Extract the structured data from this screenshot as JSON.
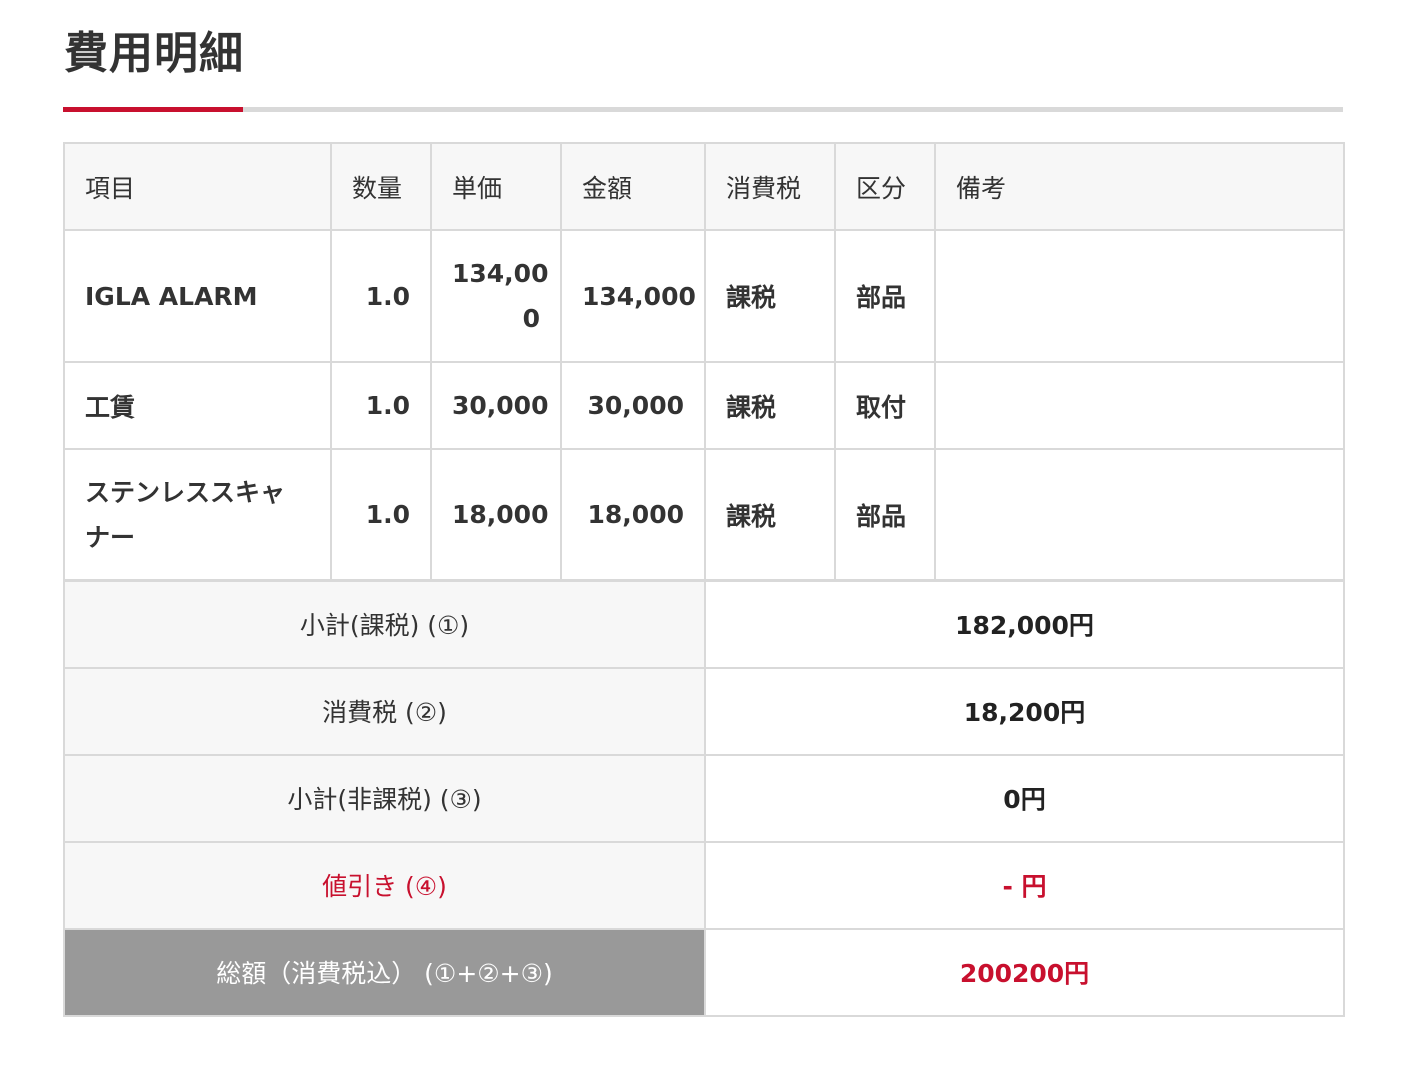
{
  "title": "費用明細",
  "table": {
    "headers": [
      "項目",
      "数量",
      "単価",
      "金額",
      "消費税",
      "区分",
      "備考"
    ],
    "rows": [
      {
        "item": "IGLA ALARM",
        "qty": "1.0",
        "unit_price_line1": "134,00",
        "unit_price_line2": "0",
        "amount": "134,000",
        "tax": "課税",
        "category": "部品",
        "note": ""
      },
      {
        "item": "工賃",
        "qty": "1.0",
        "unit_price": "30,000",
        "amount": "30,000",
        "tax": "課税",
        "category": "取付",
        "note": ""
      },
      {
        "item_line1": "ステンレススキャ",
        "item_line2": "ナー",
        "qty": "1.0",
        "unit_price": "18,000",
        "amount": "18,000",
        "tax": "課税",
        "category": "部品",
        "note": ""
      }
    ]
  },
  "totals": {
    "subtotal_taxable": {
      "label": "小計(課税) (①)",
      "value": "182,000円"
    },
    "consumption_tax": {
      "label": "消費税 (②)",
      "value": "18,200円"
    },
    "subtotal_nontaxable": {
      "label": "小計(非課税) (③)",
      "value": "0円"
    },
    "discount": {
      "label": "値引き (④)",
      "value": "- 円"
    },
    "grand_total": {
      "label": "総額（消費税込） (①+②+③)",
      "value": "200200円"
    }
  },
  "colors": {
    "accent": "#c8102e",
    "border": "#d9d9d9",
    "header_bg": "#f7f7f7",
    "grand_label_bg": "#999999"
  }
}
